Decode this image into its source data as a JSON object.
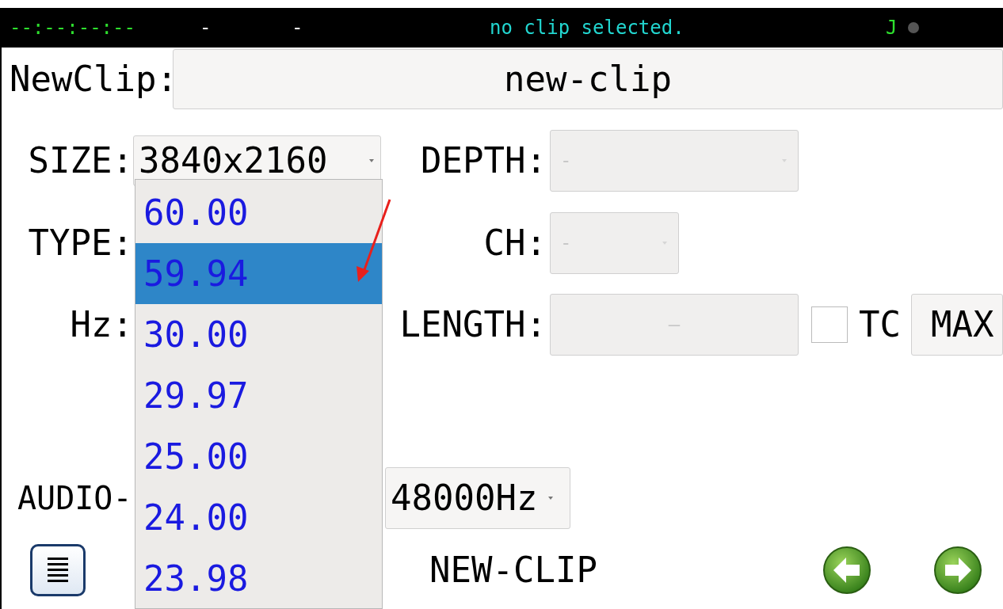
{
  "status_bar": {
    "timecode": "--:--:--:--",
    "field_2": "-",
    "field_3": "-",
    "message": "no clip selected.",
    "indicator": "J"
  },
  "name_row": {
    "label": "NewClip:",
    "value": "new-clip"
  },
  "size": {
    "label": "SIZE:",
    "value": "3840x2160"
  },
  "depth": {
    "label": "DEPTH:",
    "value": "-",
    "disabled": true
  },
  "type": {
    "label": "TYPE:"
  },
  "ch": {
    "label": "CH:",
    "value": "-",
    "disabled": true
  },
  "hz": {
    "label": "Hz:"
  },
  "length": {
    "label": "LENGTH:",
    "value": "–",
    "disabled": true
  },
  "tc": {
    "label": "TC",
    "checked": false
  },
  "max_button": "MAX",
  "audio": {
    "label": "AUDIO-",
    "value": "48000Hz"
  },
  "dropdown_list": [
    {
      "label": "60.00",
      "selected": false
    },
    {
      "label": "59.94",
      "selected": true
    },
    {
      "label": "30.00",
      "selected": false
    },
    {
      "label": "29.97",
      "selected": false
    },
    {
      "label": "25.00",
      "selected": false
    },
    {
      "label": "24.00",
      "selected": false
    },
    {
      "label": "23.98",
      "selected": false
    }
  ],
  "footer": {
    "title": "NEW-CLIP"
  }
}
